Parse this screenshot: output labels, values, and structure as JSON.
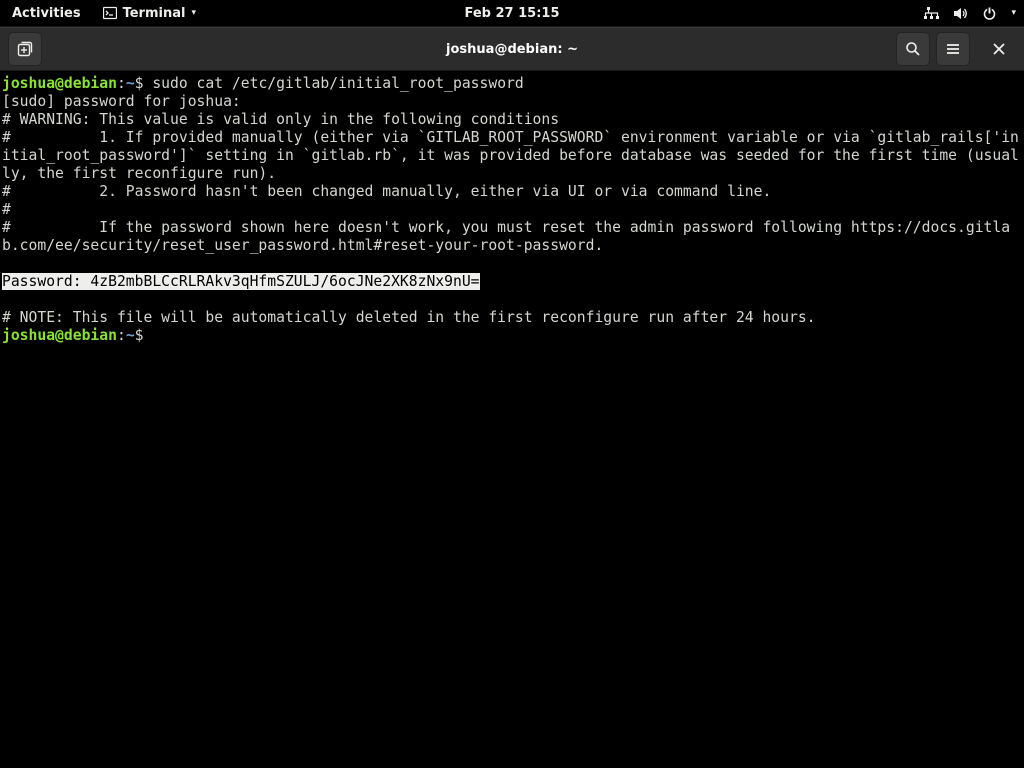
{
  "topbar": {
    "activities": "Activities",
    "app_name": "Terminal",
    "clock": "Feb 27  15:15"
  },
  "headerbar": {
    "title": "joshua@debian: ~"
  },
  "terminal": {
    "prompt_user": "joshua@debian",
    "prompt_path": "~",
    "prompt_suffix": "$",
    "command1": "sudo cat /etc/gitlab/initial_root_password",
    "line_sudo": "[sudo] password for joshua:",
    "line_warning": "# WARNING: This value is valid only in the following conditions",
    "line_cond1": "#          1. If provided manually (either via `GITLAB_ROOT_PASSWORD` environment variable or via `gitlab_rails['initial_root_password']` setting in `gitlab.rb`, it was provided before database was seeded for the first time (usually, the first reconfigure run).",
    "line_cond2": "#          2. Password hasn't been changed manually, either via UI or via command line.",
    "line_hash": "#",
    "line_reset": "#          If the password shown here doesn't work, you must reset the admin password following https://docs.gitlab.com/ee/security/reset_user_password.html#reset-your-root-password.",
    "password_line": "Password: 4zB2mbBLCcRLRAkv3qHfmSZULJ/6ocJNe2XK8zNx9nU=",
    "line_note": "# NOTE: This file will be automatically deleted in the first reconfigure run after 24 hours."
  }
}
